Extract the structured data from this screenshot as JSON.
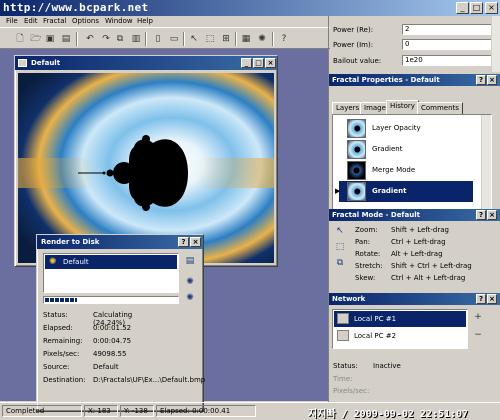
{
  "app": {
    "watermark_top": "http://www.bcpark.net",
    "watermark_bottom": "지지빠 / 2009-09-02 22:51:07"
  },
  "menu": [
    "File",
    "Edit",
    "Fractal",
    "Options",
    "Window",
    "Help"
  ],
  "toolbar_icons": [
    "new-icon",
    "open-icon",
    "save-icon",
    "save-as-icon",
    "undo-icon",
    "redo-icon",
    "copy-icon",
    "paste-icon",
    "view-icon",
    "view-fit-icon",
    "select-icon",
    "crop-icon",
    "zoom-icon",
    "render-icon",
    "gradient-icon",
    "help-icon"
  ],
  "fractal_window": {
    "title": "Default"
  },
  "render": {
    "title": "Render to Disk",
    "queue_item": "Default",
    "progress": 0.2424,
    "rows": [
      {
        "label": "Status:",
        "value": "Calculating (24.24%)"
      },
      {
        "label": "Elapsed:",
        "value": "0:00:01.52"
      },
      {
        "label": "Remaining:",
        "value": "0:00:04.75"
      },
      {
        "label": "Pixels/sec:",
        "value": "49098.55"
      },
      {
        "label": "Source:",
        "value": "Default"
      },
      {
        "label": "Destination:",
        "value": "D:\\Fractals\\UF\\Ex...\\Default.bmp"
      }
    ]
  },
  "props_top": [
    {
      "label": "Power (Re):",
      "value": "2"
    },
    {
      "label": "Power (Im):",
      "value": "0"
    },
    {
      "label": "Bailout value:",
      "value": "1e20"
    }
  ],
  "fractal_props": {
    "title": "Fractal Properties - Default",
    "tabs": [
      "Layers",
      "Image",
      "History",
      "Comments"
    ],
    "active_tab": "History",
    "history": [
      "Layer Opacity",
      "Gradient",
      "Merge Mode",
      "Gradient"
    ],
    "selected_index": 3
  },
  "fractal_mode": {
    "title": "Fractal Mode - Default",
    "rows": [
      {
        "label": "Zoom:",
        "value": "Shift + Left-drag"
      },
      {
        "label": "Pan:",
        "value": "Ctrl + Left-drag"
      },
      {
        "label": "Rotate:",
        "value": "Alt + Left-drag"
      },
      {
        "label": "Stretch:",
        "value": "Shift + Ctrl + Left-drag"
      },
      {
        "label": "Skew:",
        "value": "Ctrl + Alt + Left-drag"
      }
    ]
  },
  "network": {
    "title": "Network",
    "items": [
      "Local PC #1",
      "Local PC #2"
    ],
    "status_label": "Status:",
    "status_value": "Inactive",
    "time_label": "Time:",
    "pixels_label": "Pixels/sec:"
  },
  "statusbar": {
    "state": "Completed",
    "x": "X: 183",
    "y": "Y: -138",
    "elapsed": "Elapsed: 0:00:00.41"
  },
  "colors": {
    "title_active": "#0a246a",
    "mdi_bg": "#6b6fa0",
    "selection": "#0a246a"
  }
}
